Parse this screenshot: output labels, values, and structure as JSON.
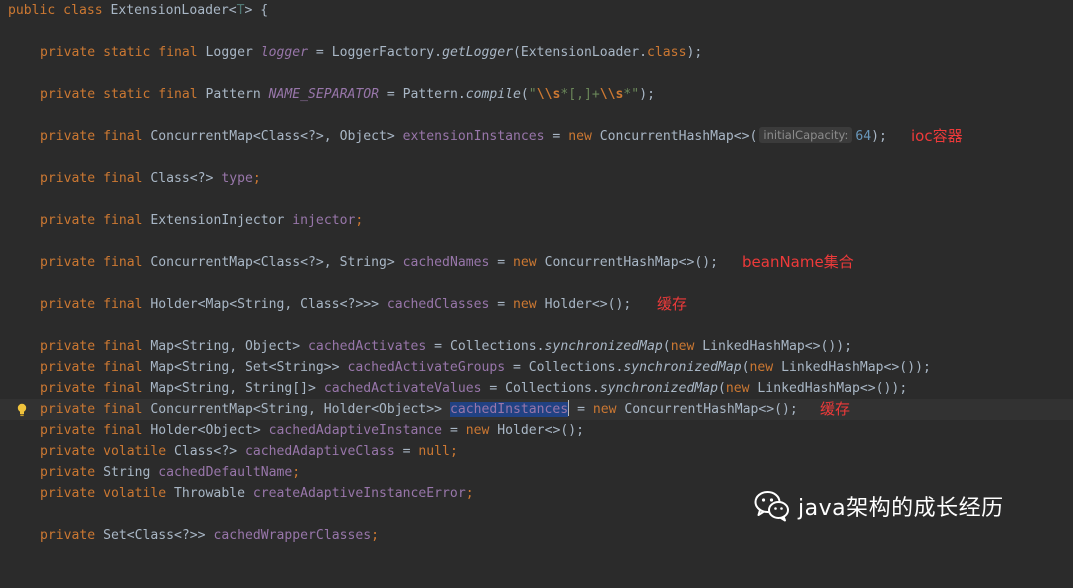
{
  "editor": {
    "line1": {
      "a": "public class ",
      "b": "ExtensionLoader<",
      "c": "T",
      "d": "> {"
    },
    "line2": {
      "a": "private static final ",
      "b": "Logger ",
      "c": "logger",
      "d": " = LoggerFactory.",
      "e": "getLogger",
      "f": "(ExtensionLoader.",
      "g": "class",
      "h": ");"
    },
    "line3": {
      "a": "private static final ",
      "b": "Pattern ",
      "c": "NAME_SEPARATOR",
      "d": " = Pattern.",
      "e": "compile",
      "f": "(",
      "g": "\"",
      "h": "\\\\s",
      "i": "*[,]+",
      "j": "\\\\s",
      "k": "*\"",
      "l": ");"
    },
    "line4": {
      "a": "private final ",
      "b": "ConcurrentMap<Class<?>, Object> ",
      "c": "extensionInstances",
      "d": " = ",
      "e": "new ",
      "f": "ConcurrentHashMap<>(",
      "hint": "initialCapacity:",
      "g": "64",
      "h": ");"
    },
    "line5": {
      "a": "private final ",
      "b": "Class<?> ",
      "c": "type",
      "d": ";"
    },
    "line6": {
      "a": "private final ",
      "b": "ExtensionInjector ",
      "c": "injector",
      "d": ";"
    },
    "line7": {
      "a": "private final ",
      "b": "ConcurrentMap<Class<?>, String> ",
      "c": "cachedNames",
      "d": " = ",
      "e": "new ",
      "f": "ConcurrentHashMap<>();"
    },
    "line8": {
      "a": "private final ",
      "b": "Holder<Map<String, Class<?>>> ",
      "c": "cachedClasses",
      "d": " = ",
      "e": "new ",
      "f": "Holder<>();"
    },
    "line9": {
      "a": "private final ",
      "b": "Map<String, Object> ",
      "c": "cachedActivates",
      "d": " = Collections.",
      "e": "synchronizedMap",
      "f": "(",
      "g": "new ",
      "h": "LinkedHashMap<>());"
    },
    "line10": {
      "a": "private final ",
      "b": "Map<String, Set<String>> ",
      "c": "cachedActivateGroups",
      "d": " = Collections.",
      "e": "synchronizedMap",
      "f": "(",
      "g": "new ",
      "h": "LinkedHashMap<>());"
    },
    "line11": {
      "a": "private final ",
      "b": "Map<String, String[]> ",
      "c": "cachedActivateValues",
      "d": " = Collections.",
      "e": "synchronizedMap",
      "f": "(",
      "g": "new ",
      "h": "LinkedHashMap<>());"
    },
    "line12": {
      "a": "private final ",
      "b": "ConcurrentMap<String, Holder<Object>> ",
      "c": "cachedInstances",
      "d": " = ",
      "e": "new ",
      "f": "ConcurrentHashMap<>();"
    },
    "line13": {
      "a": "private final ",
      "b": "Holder<Object> ",
      "c": "cachedAdaptiveInstance",
      "d": " = ",
      "e": "new ",
      "f": "Holder<>();"
    },
    "line14": {
      "a": "private volatile ",
      "b": "Class<?> ",
      "c": "cachedAdaptiveClass",
      "d": " = ",
      "e": "null",
      "f": ";"
    },
    "line15": {
      "a": "private ",
      "b": "String ",
      "c": "cachedDefaultName",
      "d": ";"
    },
    "line16": {
      "a": "private volatile ",
      "b": "Throwable ",
      "c": "createAdaptiveInstanceError",
      "d": ";"
    },
    "line17": {
      "a": "private ",
      "b": "Set<Class<?>> ",
      "c": "cachedWrapperClasses",
      "d": ";"
    }
  },
  "annotations": {
    "ioc": "ioc容器",
    "beanname": "beanName集合",
    "cache1": "缓存",
    "cache2": "缓存"
  },
  "watermark": {
    "text": "java架构的成长经历",
    "icon": "wechat-icon"
  },
  "colors": {
    "background": "#2b2b2b",
    "keyword": "#cc7832",
    "field": "#9876aa",
    "string": "#6a8759",
    "number": "#6897bb",
    "annotation": "#ee3a3a",
    "selection": "#214283"
  }
}
